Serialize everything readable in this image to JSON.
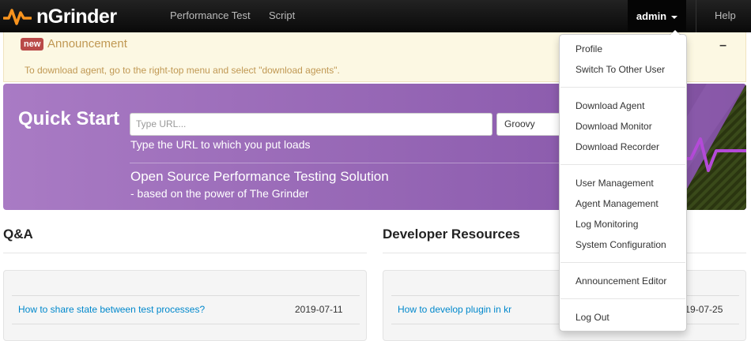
{
  "navbar": {
    "brand": "nGrinder",
    "links": [
      "Performance Test",
      "Script"
    ],
    "user": "admin",
    "help": "Help"
  },
  "announcement": {
    "badge": "new",
    "title": "Announcement",
    "collapse": "–",
    "body": "To download agent, go to the right-top menu and select \"download agents\"."
  },
  "quick_start": {
    "title": "Quick Start",
    "url_placeholder": "Type URL...",
    "script_type": "Groovy",
    "hint": "Type the URL to which you put loads",
    "slogan": "Open Source Performance Testing Solution",
    "sub": "- based on the power of The Grinder"
  },
  "qa": {
    "title": "Q&A",
    "rows": [
      {
        "title": "How to share state between test processes?",
        "date": "2019-07-11"
      }
    ]
  },
  "dev": {
    "title": "Developer Resources",
    "rows": [
      {
        "title": "How to develop plugin in kr",
        "date": "2019-07-25"
      }
    ]
  },
  "user_menu": {
    "items": [
      "Profile",
      "Switch To Other User",
      "Download Agent",
      "Download Monitor",
      "Download Recorder",
      "User Management",
      "Agent Management",
      "Log Monitoring",
      "System Configuration",
      "Announcement Editor",
      "Log Out"
    ]
  },
  "colors": {
    "brand_orange": "#f7931e",
    "announce_text": "#c09853",
    "badge_red": "#b94a48",
    "quickstart_purple": "#9a6bb8",
    "link_blue": "#0088cc"
  }
}
